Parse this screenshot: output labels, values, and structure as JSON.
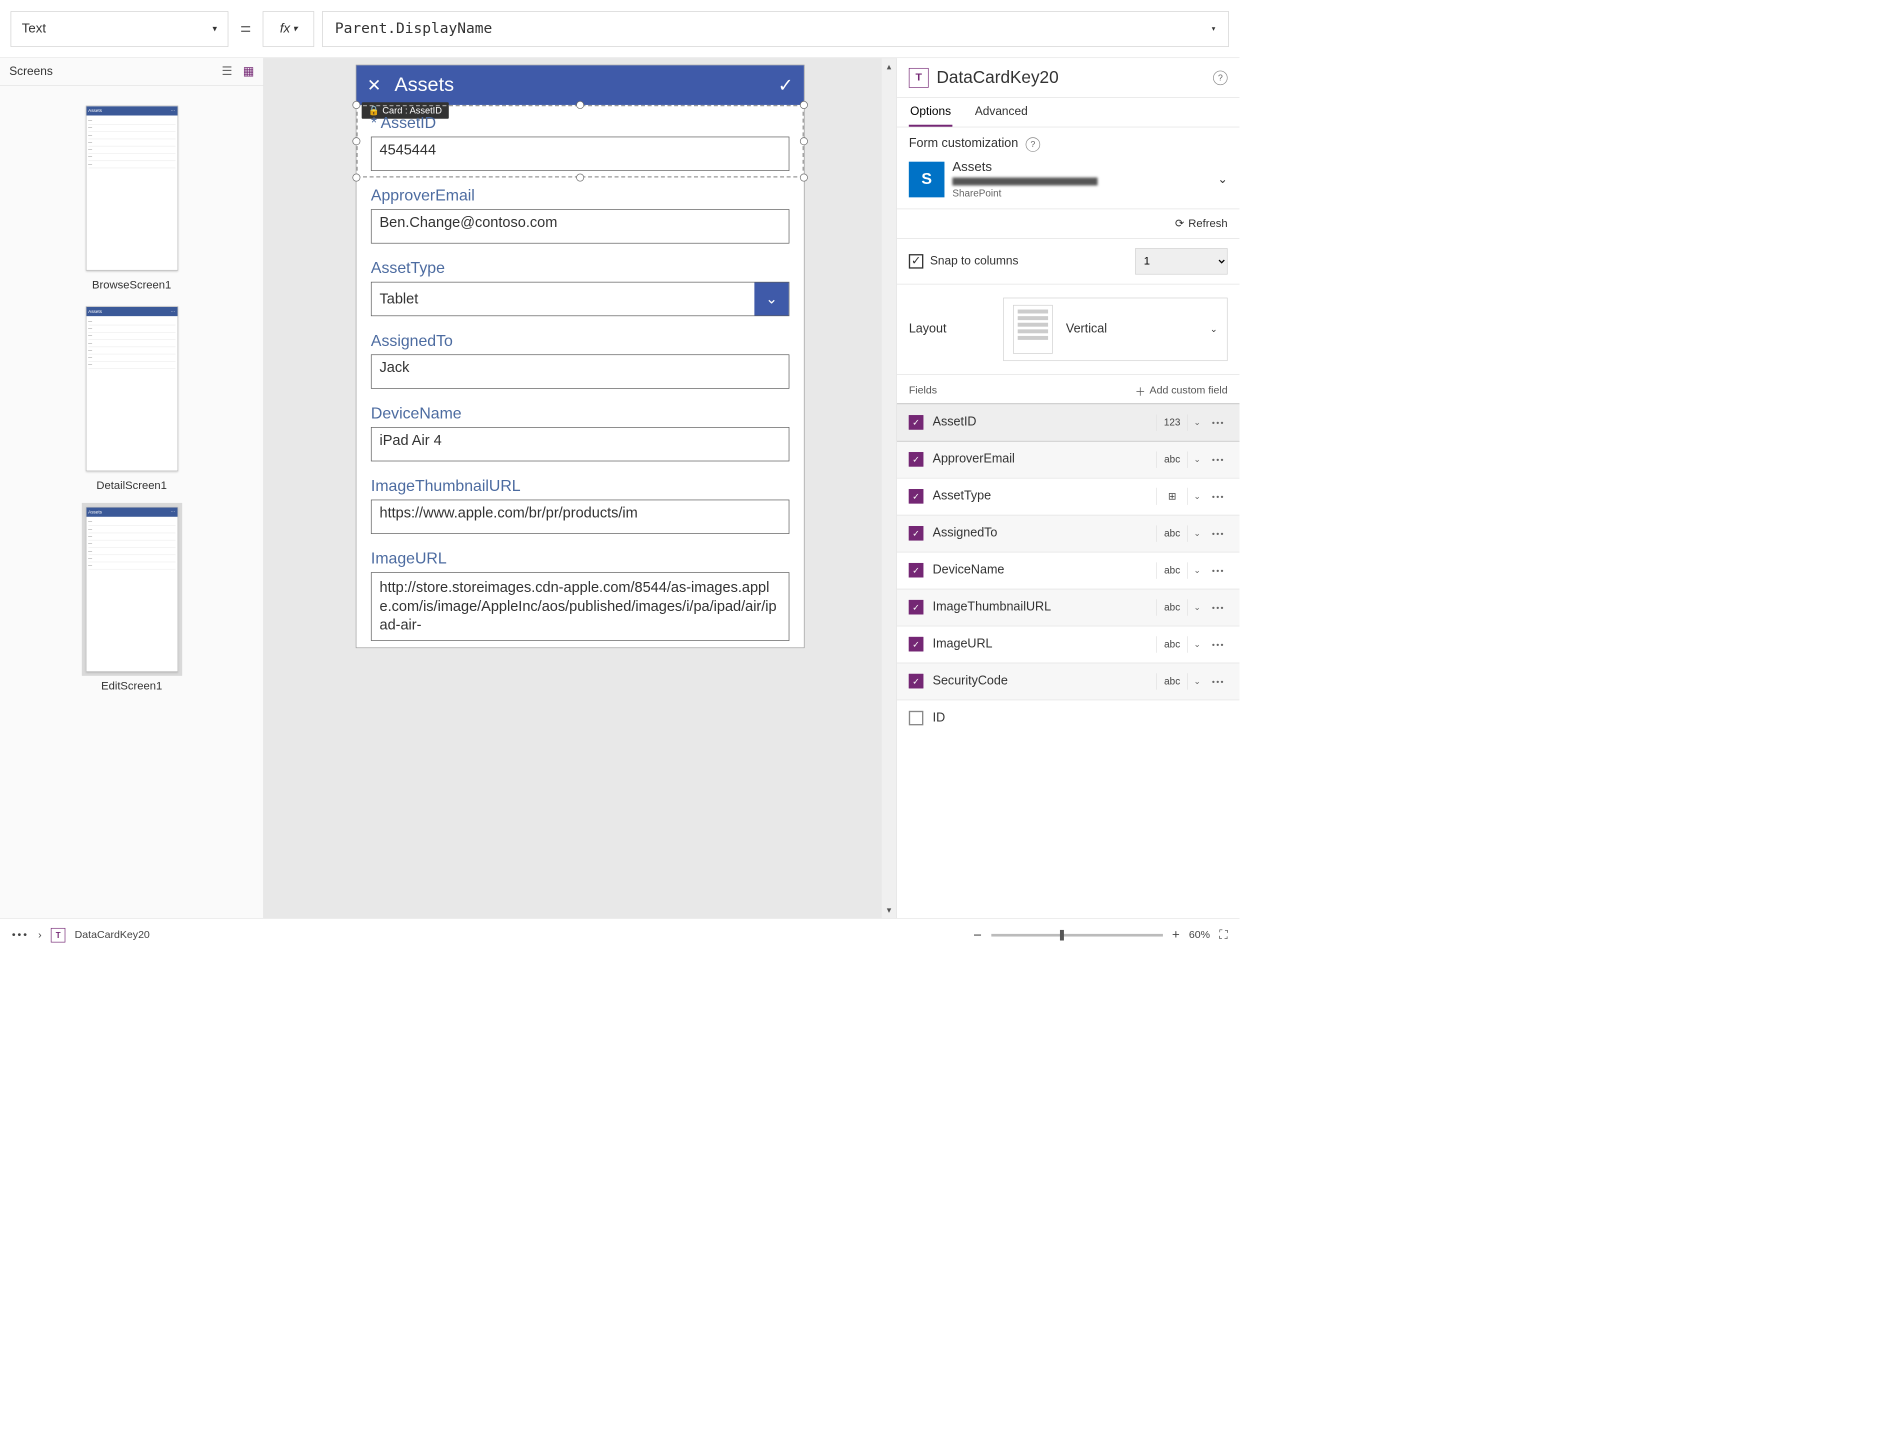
{
  "formulaBar": {
    "property": "Text",
    "fxLabel": "fx",
    "formula": "Parent.DisplayName"
  },
  "leftPane": {
    "title": "Screens",
    "screens": [
      {
        "name": "BrowseScreen1",
        "selected": false
      },
      {
        "name": "DetailScreen1",
        "selected": false
      },
      {
        "name": "EditScreen1",
        "selected": true
      }
    ]
  },
  "canvas": {
    "appTitle": "Assets",
    "tooltip": "Card : AssetID",
    "cards": [
      {
        "label": "AssetID",
        "required": true,
        "type": "text",
        "value": "4545444",
        "selected": true
      },
      {
        "label": "ApproverEmail",
        "type": "text",
        "value": "Ben.Change@contoso.com"
      },
      {
        "label": "AssetType",
        "type": "dropdown",
        "value": "Tablet"
      },
      {
        "label": "AssignedTo",
        "type": "text",
        "value": "Jack"
      },
      {
        "label": "DeviceName",
        "type": "text",
        "value": "iPad Air 4"
      },
      {
        "label": "ImageThumbnailURL",
        "type": "text",
        "value": "https://www.apple.com/br/pr/products/im"
      },
      {
        "label": "ImageURL",
        "type": "textarea",
        "value": "http://store.storeimages.cdn-apple.com/8544/as-images.apple.com/is/image/AppleInc/aos/published/images/i/pa/ipad/air/ipad-air-"
      }
    ]
  },
  "rightPane": {
    "controlName": "DataCardKey20",
    "tabs": {
      "options": "Options",
      "advanced": "Advanced"
    },
    "formCustomization": "Form customization",
    "dataSource": {
      "name": "Assets",
      "type": "SharePoint"
    },
    "refresh": "Refresh",
    "snapToColumns": "Snap to columns",
    "snapValue": "1",
    "layoutLabel": "Layout",
    "layoutValue": "Vertical",
    "fieldsLabel": "Fields",
    "addCustom": "Add custom field",
    "fields": [
      {
        "name": "AssetID",
        "type": "123",
        "checked": true,
        "selected": true
      },
      {
        "name": "ApproverEmail",
        "type": "abc",
        "checked": true
      },
      {
        "name": "AssetType",
        "type": "⊞",
        "checked": true
      },
      {
        "name": "AssignedTo",
        "type": "abc",
        "checked": true
      },
      {
        "name": "DeviceName",
        "type": "abc",
        "checked": true
      },
      {
        "name": "ImageThumbnailURL",
        "type": "abc",
        "checked": true
      },
      {
        "name": "ImageURL",
        "type": "abc",
        "checked": true
      },
      {
        "name": "SecurityCode",
        "type": "abc",
        "checked": true
      },
      {
        "name": "ID",
        "type": "",
        "checked": false
      }
    ]
  },
  "footer": {
    "breadcrumb": "DataCardKey20",
    "zoom": "60%"
  }
}
